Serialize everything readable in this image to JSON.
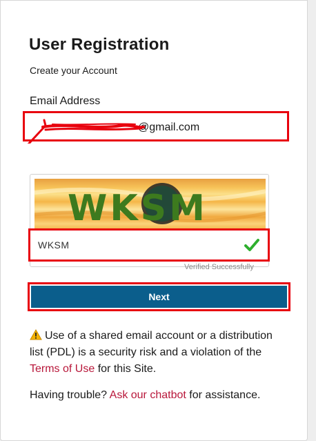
{
  "page": {
    "title": "User Registration",
    "subtitle": "Create your Account"
  },
  "email": {
    "label": "Email Address",
    "value_visible": "@gmail.com"
  },
  "captcha": {
    "image_text": "WKSM",
    "input_value": "WKSM",
    "verified_text": "Verified Successfully"
  },
  "actions": {
    "next_label": "Next"
  },
  "notice": {
    "text_before_link": "Use of a shared email account or a distribution list (PDL) is a security risk and a violation of the",
    "link_text": "Terms of Use",
    "text_after_link": "for this Site."
  },
  "help": {
    "prefix": "Having trouble?",
    "link_text": "Ask our chatbot",
    "suffix": "for assistance."
  },
  "colors": {
    "primary_button": "#0b5e8c",
    "link": "#b8173a",
    "highlight_border": "#e8000d",
    "success": "#2eaf2e"
  }
}
